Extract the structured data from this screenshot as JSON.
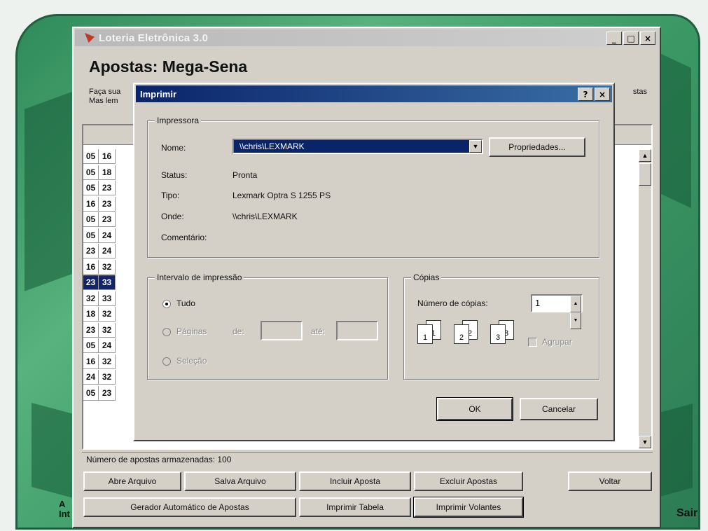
{
  "app": {
    "title": "Loteria Eletrônica 3.0",
    "heading": "Apostas: Mega-Sena",
    "description_line1": "Faça sua",
    "description_line2": "Mas lem",
    "description_right": "stas",
    "window_buttons": {
      "minimize": "_",
      "maximize": "□",
      "close": "×"
    },
    "rows": [
      [
        "05",
        "16"
      ],
      [
        "05",
        "18"
      ],
      [
        "05",
        "23"
      ],
      [
        "16",
        "23"
      ],
      [
        "05",
        "23"
      ],
      [
        "05",
        "24"
      ],
      [
        "23",
        "24"
      ],
      [
        "16",
        "32"
      ],
      [
        "23",
        "33"
      ],
      [
        "32",
        "33"
      ],
      [
        "18",
        "32"
      ],
      [
        "23",
        "32"
      ],
      [
        "05",
        "24"
      ],
      [
        "16",
        "32"
      ],
      [
        "24",
        "32"
      ],
      [
        "05",
        "23"
      ]
    ],
    "selected_row": 8,
    "status": "Número de apostas armazenadas: 100",
    "buttons": {
      "abre_arquivo": "Abre Arquivo",
      "salva_arquivo": "Salva Arquivo",
      "incluir_aposta": "Incluir Aposta",
      "excluir_apostas": "Excluir Apostas",
      "voltar": "Voltar",
      "gerador": "Gerador Automático de Apostas",
      "imprimir_tabela": "Imprimir Tabela",
      "imprimir_volantes": "Imprimir Volantes"
    },
    "side_left": "A\nInt",
    "side_right": "Sair"
  },
  "print_dialog": {
    "title": "Imprimir",
    "help_button": "?",
    "close_button": "×",
    "printer_group": "Impressora",
    "name_label": "Nome:",
    "name_value": "\\\\chris\\LEXMARK",
    "properties_button": "Propriedades...",
    "status_label": "Status:",
    "status_value": "Pronta",
    "type_label": "Tipo:",
    "type_value": "Lexmark Optra S 1255 PS",
    "where_label": "Onde:",
    "where_value": "\\\\chris\\LEXMARK",
    "comment_label": "Comentário:",
    "range_group": "Intervalo de impressão",
    "all_label": "Tudo",
    "pages_label": "Páginas",
    "from_label": "de:",
    "to_label": "até:",
    "selection_label": "Seleção",
    "copies_group": "Cópias",
    "copies_label": "Número de cópias:",
    "copies_value": "1",
    "collate_label": "Agrupar",
    "ok_button": "OK",
    "cancel_button": "Cancelar"
  },
  "colors": {
    "dialog_title_start": "#0a246a",
    "dialog_title_end": "#3a6ea5",
    "selection": "#14246b",
    "background_green": "#3c9a66"
  }
}
